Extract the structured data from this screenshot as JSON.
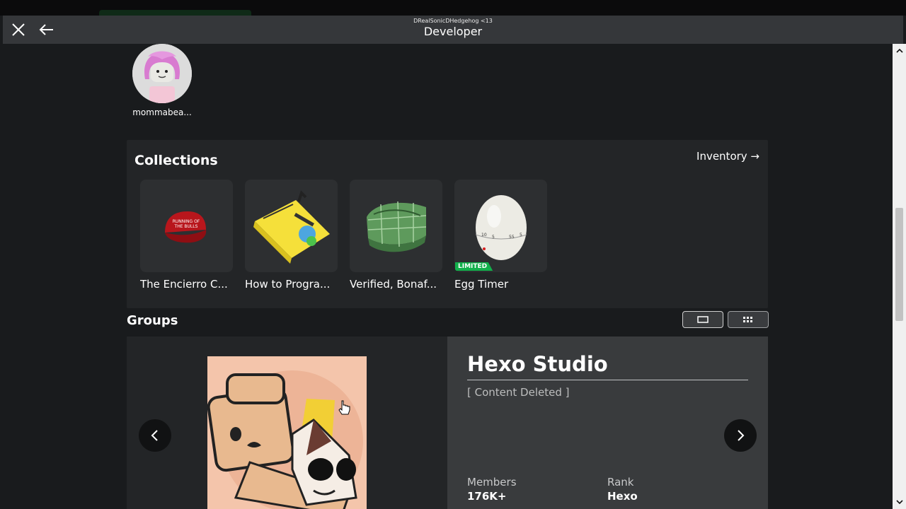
{
  "titlebar": {
    "username": "DRealSonicDHedgehog <13",
    "title": "Developer"
  },
  "friend": {
    "name": "mommabea..."
  },
  "collections": {
    "title": "Collections",
    "inventory_link": "Inventory →",
    "items": [
      {
        "name": "The Encierro C...",
        "icon": "red-cap-icon",
        "limited": false
      },
      {
        "name": "How to Progra...",
        "icon": "book-hat-icon",
        "limited": false
      },
      {
        "name": "Verified, Bonaf...",
        "icon": "green-plaid-cap-icon",
        "limited": false
      },
      {
        "name": "Egg Timer",
        "icon": "egg-timer-icon",
        "limited": true,
        "badge": "LIMITED"
      }
    ]
  },
  "groups": {
    "title": "Groups",
    "name": "Hexo Studio",
    "description": "[ Content Deleted ]",
    "members_label": "Members",
    "members_value": "176K+",
    "rank_label": "Rank",
    "rank_value": "Hexo"
  },
  "colors": {
    "background": "#191b1d",
    "panel": "#232527",
    "info_panel": "#393b3d",
    "limited_badge": "#12b04b"
  }
}
